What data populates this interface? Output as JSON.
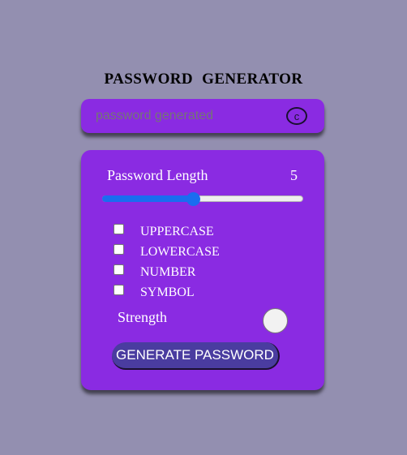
{
  "app": {
    "title": "PASSWORD  GENERATOR"
  },
  "display": {
    "placeholder": "password generated",
    "value": "",
    "copy_label": "c"
  },
  "length": {
    "label": "Password Length",
    "value": "5",
    "slider_fraction": 0.45
  },
  "options": [
    {
      "label": "UPPERCASE",
      "checked": false
    },
    {
      "label": "LOWERCASE",
      "checked": false
    },
    {
      "label": "NUMBER",
      "checked": false
    },
    {
      "label": "SYMBOL",
      "checked": false
    }
  ],
  "strength": {
    "label": "Strength",
    "indicator_color": "#f2f2f2"
  },
  "generate_button": {
    "label": "GENERATE PASSWORD"
  },
  "colors": {
    "background": "#938fb0",
    "panel": "#8a2be2",
    "button": "#4a3ca0",
    "slider_fill": "#1a6cf0"
  }
}
